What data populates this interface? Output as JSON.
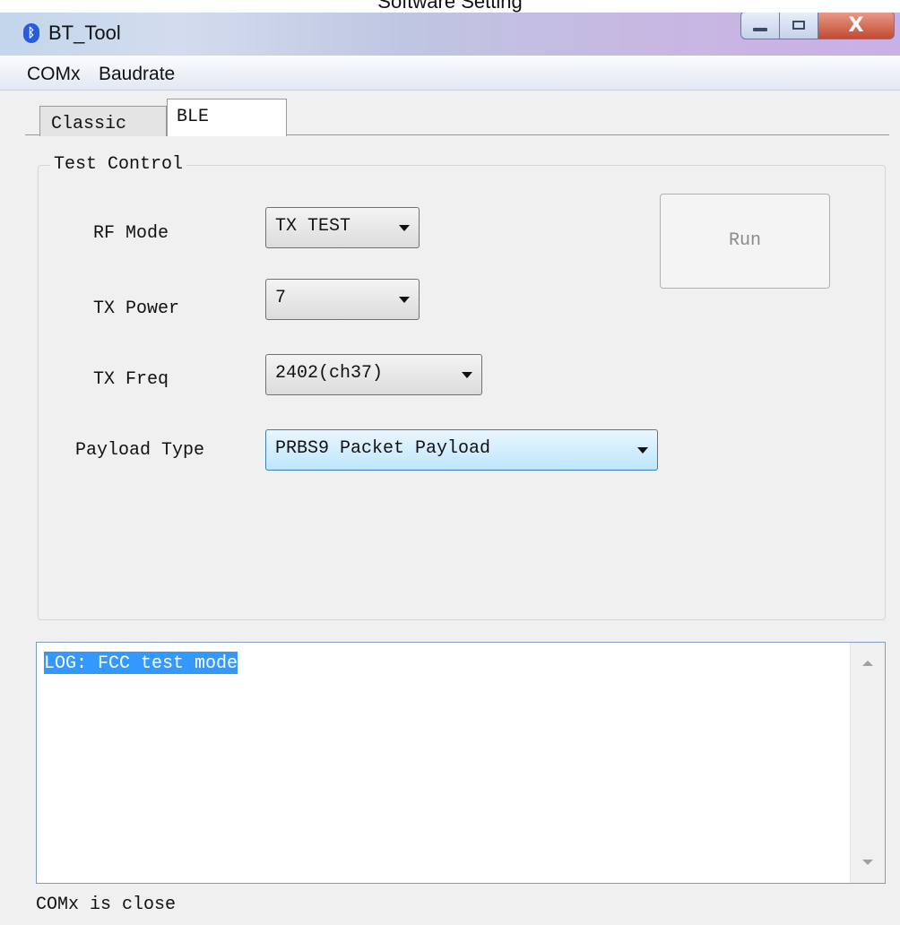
{
  "caption": "Software Setting",
  "window": {
    "title": "BT_Tool",
    "icon": "bluetooth-icon",
    "controls": {
      "close_glyph": "X"
    }
  },
  "menu": {
    "items": [
      "COMx",
      "Baudrate"
    ]
  },
  "tabs": [
    {
      "label": "Classic",
      "selected": false
    },
    {
      "label": "BLE",
      "selected": true
    }
  ],
  "test_control": {
    "title": "Test Control",
    "rf_mode": {
      "label": "RF Mode",
      "value": "TX TEST"
    },
    "tx_power": {
      "label": "TX Power",
      "value": "7"
    },
    "tx_freq": {
      "label": "TX Freq",
      "value": "2402(ch37)"
    },
    "payload_type": {
      "label": "Payload Type",
      "value": "PRBS9 Packet Payload"
    },
    "run_label": "Run"
  },
  "log": {
    "lines": [
      "LOG: FCC test mode"
    ]
  },
  "status": "COMx is close"
}
